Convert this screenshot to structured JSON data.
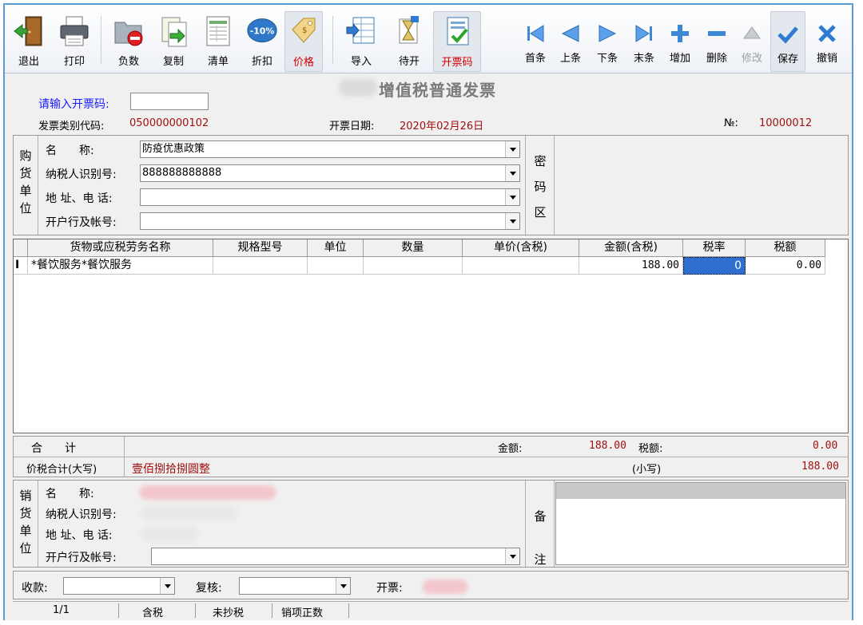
{
  "toolbar": {
    "exit": "退出",
    "print": "打印",
    "negative": "负数",
    "copy": "复制",
    "list": "清单",
    "discount": "折扣",
    "discount_badge": "-10%",
    "price": "价格",
    "import": "导入",
    "pending": "待开",
    "invoice_code": "开票码",
    "first": "首条",
    "prev": "上条",
    "next": "下条",
    "last": "末条",
    "add": "增加",
    "delete": "删除",
    "edit": "修改",
    "save": "保存",
    "cancel": "撤销"
  },
  "header": {
    "title": "增值税普通发票",
    "enter_code_label": "请输入开票码:",
    "type_code_label": "发票类别代码:",
    "type_code": "050000000102",
    "date_label": "开票日期:",
    "date": "2020年02月26日",
    "no_label": "№:",
    "no": "10000012"
  },
  "buyer": {
    "section_label": [
      "购",
      "货",
      "单",
      "位"
    ],
    "name_label": "名　　称:",
    "name": "防疫优惠政策",
    "taxid_label": "纳税人识别号:",
    "taxid": "888888888888",
    "address_label": "地 址、电 话:",
    "address": "",
    "bank_label": "开户行及帐号:",
    "bank": "",
    "cipher_label": [
      "密",
      "码",
      "区"
    ]
  },
  "table": {
    "headers": [
      "货物或应税劳务名称",
      "规格型号",
      "单位",
      "数量",
      "单价(含税)",
      "金额(含税)",
      "税率",
      "税额"
    ],
    "rows": [
      {
        "marker": "I",
        "name": "*餐饮服务*餐饮服务",
        "spec": "",
        "unit": "",
        "qty": "",
        "price": "",
        "amount": "188.00",
        "rate": "0",
        "tax": "0.00"
      }
    ]
  },
  "totals": {
    "sum_label": "合　　计",
    "amount_label": "金额:",
    "amount": "188.00",
    "tax_label": "税额:",
    "tax": "0.00",
    "upper_label": "价税合计(大写)",
    "upper_value": "壹佰捌拾捌圆整",
    "lower_label": "(小写)",
    "lower_value": "188.00"
  },
  "seller": {
    "section_label": [
      "销",
      "货",
      "单",
      "位"
    ],
    "name_label": "名　　称:",
    "taxid_label": "纳税人识别号:",
    "address_label": "地 址、电 话:",
    "bank_label": "开户行及帐号:",
    "remark_label": [
      "备",
      "注"
    ]
  },
  "footer": {
    "payee_label": "收款:",
    "reviewer_label": "复核:",
    "issuer_label": "开票:"
  },
  "status": {
    "page": "1/1",
    "tax_mode": "含税",
    "copy_state": "未抄税",
    "item_type": "销项正数"
  }
}
